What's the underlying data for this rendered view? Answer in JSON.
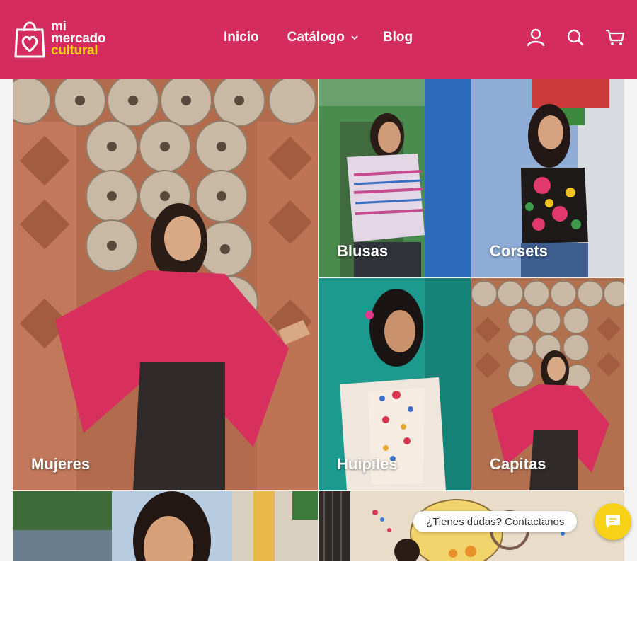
{
  "brand": {
    "line1": "mi",
    "line2": "mercado",
    "line3": "cultural",
    "primary_color": "#d42c5f",
    "accent_color": "#f7d116"
  },
  "nav": {
    "items": [
      {
        "label": "Inicio"
      },
      {
        "label": "Catálogo",
        "has_dropdown": true
      },
      {
        "label": "Blog"
      }
    ]
  },
  "header_icons": [
    "account-icon",
    "search-icon",
    "cart-icon"
  ],
  "categories": [
    {
      "label": "Mujeres"
    },
    {
      "label": "Blusas"
    },
    {
      "label": "Corsets"
    },
    {
      "label": "Huipiles"
    },
    {
      "label": "Capitas"
    }
  ],
  "chat": {
    "prompt": "¿Tienes dudas? Contactanos",
    "icon": "chat-icon"
  }
}
